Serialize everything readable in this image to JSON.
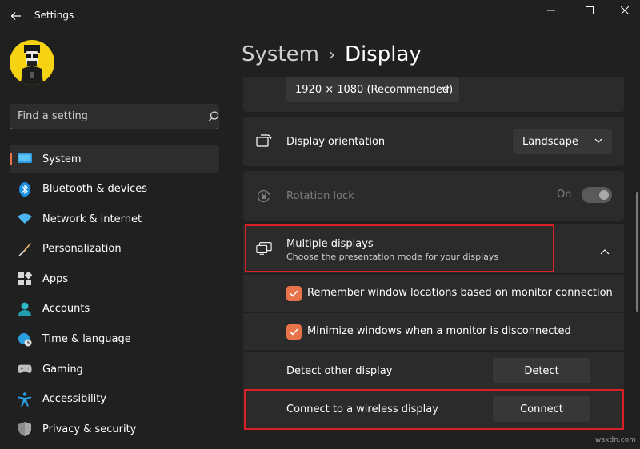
{
  "app": {
    "title": "Settings"
  },
  "window_controls": {
    "minimize_icon": "minimize-icon",
    "maximize_icon": "maximize-icon",
    "close_icon": "close-icon"
  },
  "search": {
    "placeholder": "Find a setting"
  },
  "sidebar": {
    "items": [
      {
        "label": "System",
        "icon": "system-icon",
        "active": true
      },
      {
        "label": "Bluetooth & devices",
        "icon": "bluetooth-icon"
      },
      {
        "label": "Network & internet",
        "icon": "wifi-icon"
      },
      {
        "label": "Personalization",
        "icon": "brush-icon"
      },
      {
        "label": "Apps",
        "icon": "apps-icon"
      },
      {
        "label": "Accounts",
        "icon": "person-icon"
      },
      {
        "label": "Time & language",
        "icon": "globe-clock-icon"
      },
      {
        "label": "Gaming",
        "icon": "gamepad-icon"
      },
      {
        "label": "Accessibility",
        "icon": "accessibility-icon"
      },
      {
        "label": "Privacy & security",
        "icon": "shield-icon"
      }
    ]
  },
  "breadcrumb": {
    "parent": "System",
    "separator": "›",
    "current": "Display"
  },
  "display": {
    "resolution_value": "1920 × 1080 (Recommended)",
    "orientation": {
      "label": "Display orientation",
      "value": "Landscape"
    },
    "rotation_lock": {
      "label": "Rotation lock",
      "state_label": "On",
      "on": true,
      "disabled": true
    },
    "multiple_displays": {
      "label": "Multiple displays",
      "description": "Choose the presentation mode for your displays",
      "expanded": true,
      "options": [
        {
          "label": "Remember window locations based on monitor connection",
          "checked": true
        },
        {
          "label": "Minimize windows when a monitor is disconnected",
          "checked": true
        }
      ],
      "detect": {
        "label": "Detect other display",
        "button": "Detect"
      },
      "wireless": {
        "label": "Connect to a wireless display",
        "button": "Connect"
      }
    }
  },
  "colors": {
    "accent": "#e8734a",
    "highlight": "#d92027",
    "background": "#202020",
    "card": "#2b2b2b"
  },
  "watermark": "wsxdn.com"
}
